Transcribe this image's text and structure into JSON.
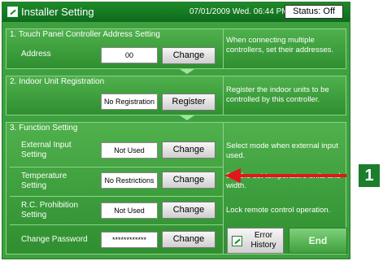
{
  "titlebar": {
    "title": "Installer Setting",
    "datetime": "07/01/2009 Wed. 06:44 PM",
    "status": "Status: Off"
  },
  "sections": {
    "touch_panel": {
      "title": "1. Touch Panel Controller Address Setting",
      "address_label": "Address",
      "address_value": "00",
      "change_label": "Change",
      "description": "When connecting multiple controllers, set their addresses."
    },
    "indoor_unit": {
      "title": "2. Indoor Unit Registration",
      "value": "No Registration",
      "register_label": "Register",
      "description": "Register the indoor units to be controlled by this controller."
    },
    "function": {
      "title": "3. Function Setting",
      "rows": [
        {
          "label": "External Input Setting",
          "value": "Not Used",
          "button": "Change",
          "description": "Select mode when external input used."
        },
        {
          "label": "Temperature Setting",
          "value": "No Restrictions",
          "button": "Change",
          "description": "Set the set temperature units and width."
        },
        {
          "label": "R.C. Prohibition Setting",
          "value": "Not Used",
          "button": "Change",
          "description": "Lock remote control operation."
        },
        {
          "label": "Change Password",
          "value": "************",
          "button": "Change"
        }
      ]
    }
  },
  "footer": {
    "error_history_label": "Error History",
    "end_label": "End"
  },
  "annotation": {
    "callout_number": "1"
  },
  "colors": {
    "panel_green": "#3fa03f",
    "title_green": "#1e8a2a",
    "arrow_red": "#e3161b",
    "callout_green": "#1c7d2c"
  },
  "icons": {
    "title_icon": "pencil-edit-icon",
    "error_icon": "pencil-edit-icon"
  }
}
